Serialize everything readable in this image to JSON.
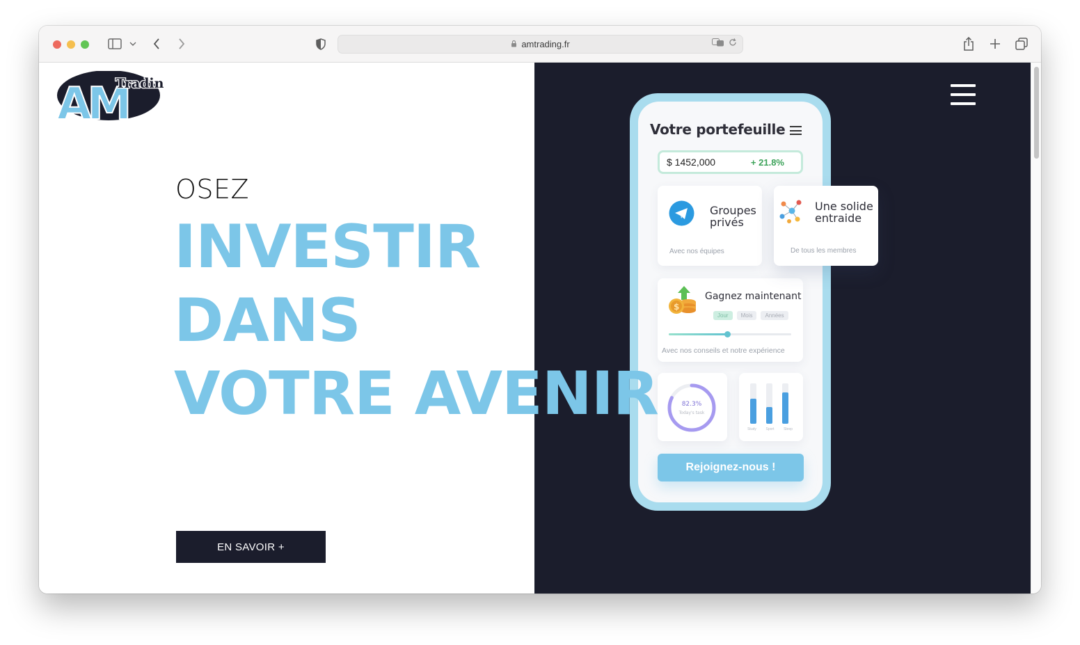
{
  "browser": {
    "url": "amtrading.fr"
  },
  "logo": {
    "letters": "AM",
    "word": "Trading"
  },
  "hero": {
    "small": "OSEZ",
    "line1": "INVESTIR",
    "line2": "DANS",
    "line3": "VOTRE AVENIR",
    "cta": "EN SAVOIR +"
  },
  "phone": {
    "title": "Votre portefeuille",
    "balance": "$ 1452,000",
    "change": "+ 21.8%",
    "card_private": {
      "title_line1": "Groupes",
      "title_line2": "privés",
      "sub": "Avec nos équipes"
    },
    "card_help": {
      "title_line1": "Une solide",
      "title_line2": "entraide",
      "sub": "De tous les membres"
    },
    "card_earn": {
      "title": "Gagnez maintenant",
      "chips": [
        "Jour",
        "Mois",
        "Années"
      ],
      "sub": "Avec nos conseils et notre expérience",
      "progress": 0.48
    },
    "donut": {
      "value_label": "82.3%",
      "caption": "Today's task",
      "value": 0.823
    },
    "bars": {
      "labels": [
        "Study",
        "Sport",
        "Sleep"
      ],
      "values": [
        0.62,
        0.42,
        0.78
      ]
    },
    "join": "Rejoignez-nous !"
  },
  "colors": {
    "accent": "#7cc6e8",
    "dark": "#1b1d2c",
    "positive": "#3da35a"
  },
  "icons": {
    "private": "telegram-icon",
    "help": "network-people-icon",
    "earn": "coins-growth-icon"
  }
}
